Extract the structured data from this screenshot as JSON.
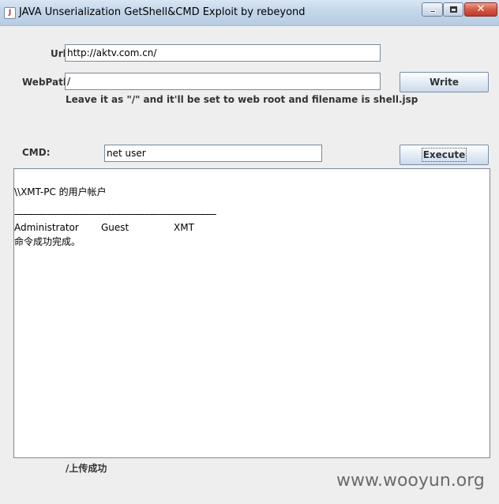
{
  "window": {
    "title": "JAVA Unserialization GetShell&CMD Exploit",
    "author": "by rebeyond",
    "close_symbol": "✕"
  },
  "form": {
    "url_label": "Url:",
    "url_value": "http://aktv.com.cn/",
    "webpath_label": "WebPath:",
    "webpath_value": "/",
    "webpath_hint": "Leave it as \"/\" and it'll be set to web root and filename is shell.jsp",
    "write_label": "Write",
    "cmd_label": "CMD:",
    "cmd_value": "net user",
    "execute_label": "Execute"
  },
  "output": {
    "host_line": "\\\\XMT-PC 的用户帐户",
    "separator": "-------------------------------------------------------------------------------",
    "accounts": [
      "Administrator",
      "Guest",
      "XMT"
    ],
    "done_line": "命令成功完成。"
  },
  "status": {
    "text": "/上传成功"
  },
  "watermark": {
    "text": "www.wooyun.org"
  }
}
